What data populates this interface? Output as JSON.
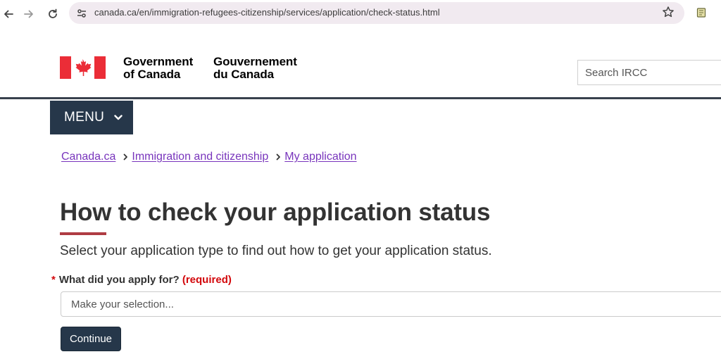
{
  "browser": {
    "url": "canada.ca/en/immigration-refugees-citizenship/services/application/check-status.html"
  },
  "header": {
    "signature_en_line1": "Government",
    "signature_en_line2": "of Canada",
    "signature_fr_line1": "Gouvernement",
    "signature_fr_line2": "du Canada",
    "search_placeholder": "Search IRCC"
  },
  "menu": {
    "label": "MENU"
  },
  "breadcrumb": [
    {
      "label": "Canada.ca"
    },
    {
      "label": "Immigration and citizenship"
    },
    {
      "label": "My application"
    }
  ],
  "main": {
    "title": "How to check your application status",
    "intro": "Select your application type to find out how to get your application status.",
    "field": {
      "required_marker": "*",
      "label": "What did you apply for?",
      "required_text": "(required)",
      "selected_option": "Make your selection..."
    },
    "continue_label": "Continue"
  },
  "colors": {
    "accent_navy": "#26374a",
    "link_purple": "#7834bc",
    "title_underline": "#af3c43",
    "flag_red": "#eb2d37",
    "required_red": "#d3080c"
  }
}
